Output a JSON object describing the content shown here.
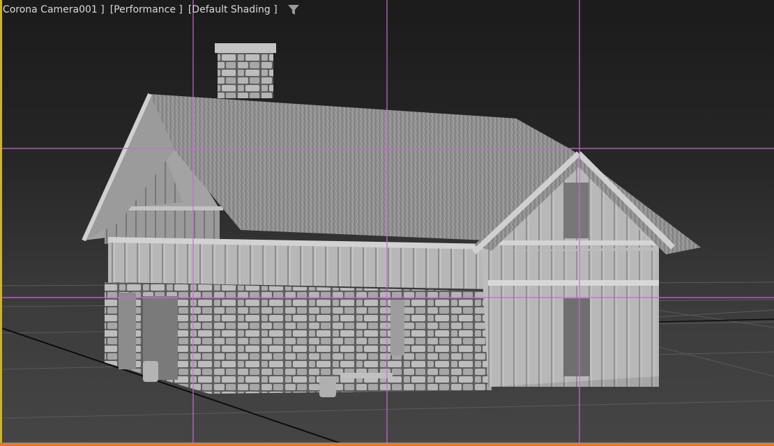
{
  "viewport": {
    "camera_label": "[ Corona Camera001 ]",
    "visual_style_label": "[Performance ]",
    "shading_label": "[Default Shading ]",
    "filter_icon": "funnel-icon",
    "colors": {
      "safe_frame_guides": "#c86ad2",
      "active_border": "#c7b23a",
      "bottom_bar": "#e0792b"
    }
  },
  "scene": {
    "object": "house-model",
    "grid": true
  }
}
